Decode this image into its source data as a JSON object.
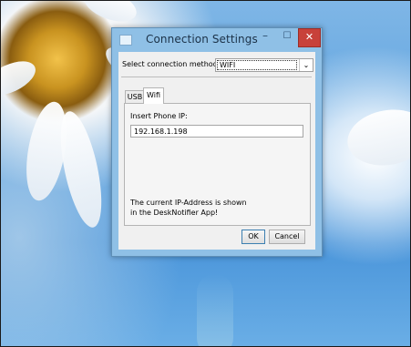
{
  "window": {
    "title": "Connection Settings",
    "minimize_glyph": "–",
    "maximize_glyph": "☐",
    "close_glyph": "✕"
  },
  "connection": {
    "label": "Select connection method:",
    "selected": "WIFI",
    "arrow": "⌄"
  },
  "tabs": [
    {
      "label": "USB",
      "active": false
    },
    {
      "label": "Wifi",
      "active": true
    }
  ],
  "wifi_panel": {
    "ip_label": "Insert Phone IP:",
    "ip_value": "192.168.1.198",
    "info_line1": "The current IP-Address is shown",
    "info_line2": "in the DeskNotifier App!"
  },
  "buttons": {
    "ok": "OK",
    "cancel": "Cancel"
  },
  "colors": {
    "close_button": "#c8413a",
    "window_frame": "#8fc0e6"
  }
}
